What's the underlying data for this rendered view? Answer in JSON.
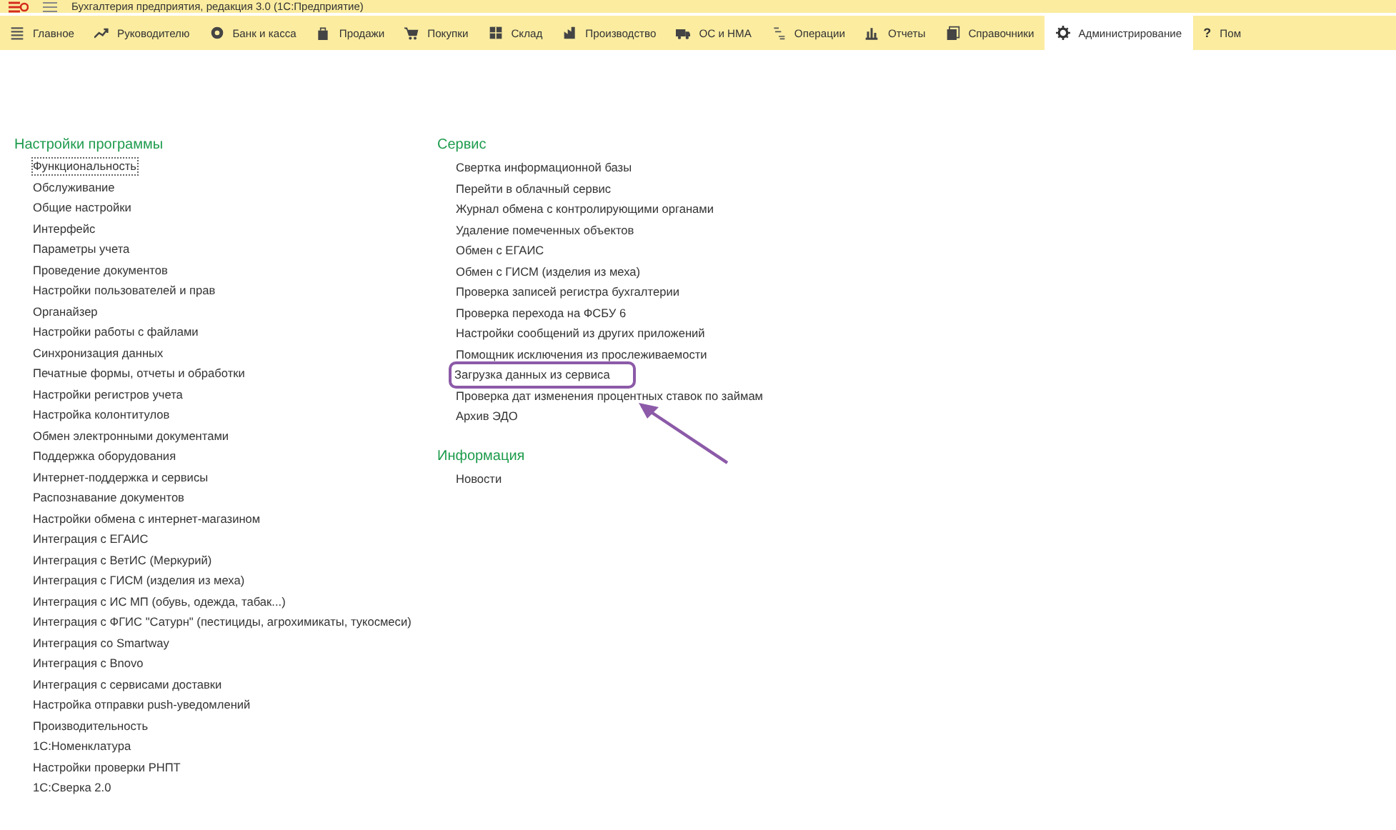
{
  "window": {
    "title": "Бухгалтерия предприятия, редакция 3.0  (1С:Предприятие)"
  },
  "tabs": [
    {
      "label": "Главное",
      "selected": false
    },
    {
      "label": "Руководителю",
      "selected": false
    },
    {
      "label": "Банк и касса",
      "selected": false
    },
    {
      "label": "Продажи",
      "selected": false
    },
    {
      "label": "Покупки",
      "selected": false
    },
    {
      "label": "Склад",
      "selected": false
    },
    {
      "label": "Производство",
      "selected": false
    },
    {
      "label": "ОС и НМА",
      "selected": false
    },
    {
      "label": "Операции",
      "selected": false
    },
    {
      "label": "Отчеты",
      "selected": false
    },
    {
      "label": "Справочники",
      "selected": false
    },
    {
      "label": "Администрирование",
      "selected": true
    },
    {
      "label": "Пом",
      "glyph": "?",
      "selected": false
    }
  ],
  "left": [
    {
      "title": "Настройки программы",
      "items": [
        {
          "label": "Функциональность",
          "focused": true,
          "highlighted": false
        },
        {
          "label": "Обслуживание",
          "focused": false,
          "highlighted": false
        },
        {
          "label": "Общие настройки",
          "focused": false,
          "highlighted": false
        },
        {
          "label": "Интерфейс",
          "focused": false,
          "highlighted": false
        },
        {
          "label": "Параметры учета",
          "focused": false,
          "highlighted": false
        },
        {
          "label": "Проведение документов",
          "focused": false,
          "highlighted": false
        },
        {
          "label": "Настройки пользователей и прав",
          "focused": false,
          "highlighted": false
        },
        {
          "label": "Органайзер",
          "focused": false,
          "highlighted": false
        },
        {
          "label": "Настройки работы с файлами",
          "focused": false,
          "highlighted": false
        },
        {
          "label": "Синхронизация данных",
          "focused": false,
          "highlighted": false
        },
        {
          "label": "Печатные формы, отчеты и обработки",
          "focused": false,
          "highlighted": false
        },
        {
          "label": "Настройки регистров учета",
          "focused": false,
          "highlighted": false
        },
        {
          "label": "Настройка колонтитулов",
          "focused": false,
          "highlighted": false
        },
        {
          "label": "Обмен электронными документами",
          "focused": false,
          "highlighted": false
        },
        {
          "label": "Поддержка оборудования",
          "focused": false,
          "highlighted": false
        },
        {
          "label": "Интернет-поддержка и сервисы",
          "focused": false,
          "highlighted": false
        },
        {
          "label": "Распознавание документов",
          "focused": false,
          "highlighted": false
        },
        {
          "label": "Настройки обмена с интернет-магазином",
          "focused": false,
          "highlighted": false
        },
        {
          "label": "Интеграция с ЕГАИС",
          "focused": false,
          "highlighted": false
        },
        {
          "label": "Интеграция с ВетИС (Меркурий)",
          "focused": false,
          "highlighted": false
        },
        {
          "label": "Интеграция с ГИСМ (изделия из меха)",
          "focused": false,
          "highlighted": false
        },
        {
          "label": "Интеграция с ИС МП (обувь, одежда, табак...)",
          "focused": false,
          "highlighted": false
        },
        {
          "label": "Интеграция с ФГИС \"Сатурн\" (пестициды, агрохимикаты, тукосмеси)",
          "focused": false,
          "highlighted": false
        },
        {
          "label": "Интеграция со Smartway",
          "focused": false,
          "highlighted": false
        },
        {
          "label": "Интеграция с Bnovo",
          "focused": false,
          "highlighted": false
        },
        {
          "label": "Интеграция с сервисами доставки",
          "focused": false,
          "highlighted": false
        },
        {
          "label": "Настройка отправки push-уведомлений",
          "focused": false,
          "highlighted": false
        },
        {
          "label": "Производительность",
          "focused": false,
          "highlighted": false
        },
        {
          "label": "1С:Номенклатура",
          "focused": false,
          "highlighted": false
        },
        {
          "label": "Настройки проверки РНПТ",
          "focused": false,
          "highlighted": false
        },
        {
          "label": "1С:Сверка 2.0",
          "focused": false,
          "highlighted": false
        }
      ]
    }
  ],
  "right": [
    {
      "title": "Сервис",
      "items": [
        {
          "label": "Свертка информационной базы",
          "focused": false,
          "highlighted": false
        },
        {
          "label": "Перейти в облачный сервис",
          "focused": false,
          "highlighted": false
        },
        {
          "label": "Журнал обмена с контролирующими органами",
          "focused": false,
          "highlighted": false
        },
        {
          "label": "Удаление помеченных объектов",
          "focused": false,
          "highlighted": false
        },
        {
          "label": "Обмен с ЕГАИС",
          "focused": false,
          "highlighted": false
        },
        {
          "label": "Обмен с ГИСМ (изделия из меха)",
          "focused": false,
          "highlighted": false
        },
        {
          "label": "Проверка записей регистра бухгалтерии",
          "focused": false,
          "highlighted": false
        },
        {
          "label": "Проверка перехода на ФСБУ 6",
          "focused": false,
          "highlighted": false
        },
        {
          "label": "Настройки сообщений из других приложений",
          "focused": false,
          "highlighted": false
        },
        {
          "label": "Помощник исключения из прослеживаемости",
          "focused": false,
          "highlighted": false
        },
        {
          "label": "Загрузка данных из сервиса",
          "focused": false,
          "highlighted": true
        },
        {
          "label": "Проверка дат изменения процентных ставок по займам",
          "focused": false,
          "highlighted": false
        },
        {
          "label": "Архив ЭДО",
          "focused": false,
          "highlighted": false
        }
      ]
    },
    {
      "title": "Информация",
      "items": [
        {
          "label": "Новости",
          "focused": false,
          "highlighted": false
        }
      ]
    }
  ]
}
